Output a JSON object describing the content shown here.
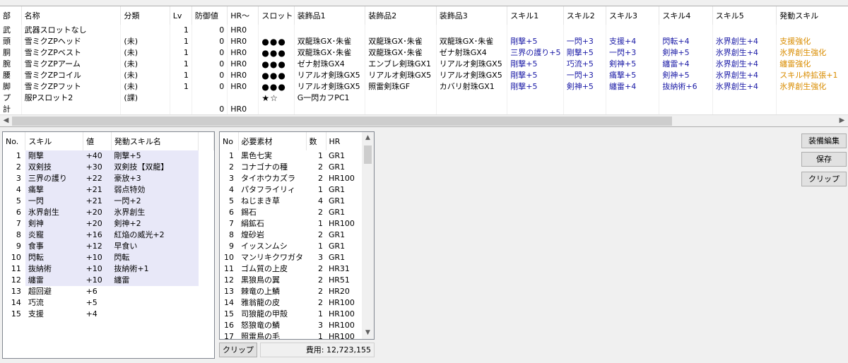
{
  "equip": {
    "headers": [
      "部",
      "名称",
      "分類",
      "Lv",
      "防御値",
      "HR〜",
      "スロット",
      "装飾品1",
      "装飾品2",
      "装飾品3",
      "スキル1",
      "スキル2",
      "スキル3",
      "スキル4",
      "スキル5",
      "発動スキル"
    ],
    "rows": [
      [
        "武",
        "武器スロットなし",
        "",
        "1",
        "0",
        "HR0",
        "",
        "",
        "",
        "",
        "",
        "",
        "",
        "",
        "",
        ""
      ],
      [
        "頭",
        "雪ミクZPヘッド",
        "(未)",
        "1",
        "0",
        "HR0",
        "●●●",
        "双龍珠GX･朱雀",
        "双龍珠GX･朱雀",
        "双龍珠GX･朱雀",
        "剛撃+5",
        "一閃+3",
        "支援+4",
        "閃転+4",
        "氷界創生+4",
        "支援強化"
      ],
      [
        "胴",
        "雪ミクZPベスト",
        "(未)",
        "1",
        "0",
        "HR0",
        "●●●",
        "双龍珠GX･朱雀",
        "双龍珠GX･朱雀",
        "ゼナ射珠GX4",
        "三界の護り+5",
        "剛撃+5",
        "一閃+3",
        "剣神+5",
        "氷界創生+4",
        "氷界創生強化"
      ],
      [
        "腕",
        "雪ミクZPアーム",
        "(未)",
        "1",
        "0",
        "HR0",
        "●●●",
        "ゼナ射珠GX4",
        "エンブレ剣珠GX1",
        "リアルオ剣珠GX5",
        "剛撃+5",
        "巧流+5",
        "剣神+5",
        "纏雷+4",
        "氷界創生+4",
        "纏雷強化"
      ],
      [
        "腰",
        "雪ミクZPコイル",
        "(未)",
        "1",
        "0",
        "HR0",
        "●●●",
        "リアルオ剣珠GX5",
        "リアルオ剣珠GX5",
        "リアルオ剣珠GX5",
        "剛撃+5",
        "一閃+3",
        "痛撃+5",
        "剣神+5",
        "氷界創生+4",
        "スキル枠拡張+1"
      ],
      [
        "脚",
        "雪ミクZPフット",
        "(未)",
        "1",
        "0",
        "HR0",
        "●●●",
        "リアルオ剣珠GX5",
        "照雷剣珠GF",
        "カバリ射珠GX1",
        "剛撃+5",
        "剣神+5",
        "纏雷+4",
        "抜納術+6",
        "氷界創生+4",
        "氷界創生強化"
      ],
      [
        "プ",
        "服Pスロット2",
        "(課)",
        "",
        "",
        "",
        "★☆",
        "G一閃カフPC1",
        "",
        "",
        "",
        "",
        "",
        "",
        "",
        ""
      ],
      [
        "計",
        "",
        "",
        "",
        "0",
        "HR0",
        "",
        "",
        "",
        "",
        "",
        "",
        "",
        "",
        "",
        ""
      ]
    ]
  },
  "skills": {
    "headers": [
      "No.",
      "スキル",
      "値",
      "発動スキル名"
    ],
    "rows": [
      [
        "1",
        "剛撃",
        "+40",
        "剛撃+5"
      ],
      [
        "2",
        "双剣技",
        "+30",
        "双剣技【双龍】"
      ],
      [
        "3",
        "三界の護り",
        "+22",
        "豪放+3"
      ],
      [
        "4",
        "痛撃",
        "+21",
        "弱点特効"
      ],
      [
        "5",
        "一閃",
        "+21",
        "一閃+2"
      ],
      [
        "6",
        "氷界創生",
        "+20",
        "氷界創生"
      ],
      [
        "7",
        "剣神",
        "+20",
        "剣神+2"
      ],
      [
        "8",
        "炎寵",
        "+16",
        "紅焔の威光+2"
      ],
      [
        "9",
        "食事",
        "+12",
        "早食い"
      ],
      [
        "10",
        "閃転",
        "+10",
        "閃転"
      ],
      [
        "11",
        "抜納術",
        "+10",
        "抜納術+1"
      ],
      [
        "12",
        "纏雷",
        "+10",
        "纏雷"
      ],
      [
        "13",
        "超回避",
        "+6",
        ""
      ],
      [
        "14",
        "巧流",
        "+5",
        ""
      ],
      [
        "15",
        "支援",
        "+4",
        ""
      ]
    ]
  },
  "materials": {
    "headers": [
      "No",
      "必要素材",
      "数",
      "HR"
    ],
    "rows": [
      [
        "1",
        "黒色七実",
        "1",
        "GR1"
      ],
      [
        "2",
        "コナゴナの種",
        "2",
        "GR1"
      ],
      [
        "3",
        "タイホウカズラ",
        "2",
        "HR100"
      ],
      [
        "4",
        "パタフライリィ",
        "1",
        "GR1"
      ],
      [
        "5",
        "ねじまき草",
        "4",
        "GR1"
      ],
      [
        "6",
        "錫石",
        "2",
        "GR1"
      ],
      [
        "7",
        "絹鉱石",
        "1",
        "HR100"
      ],
      [
        "8",
        "煌砂岩",
        "2",
        "GR1"
      ],
      [
        "9",
        "イッスンムシ",
        "1",
        "GR1"
      ],
      [
        "10",
        "マンリキクワガタ",
        "3",
        "GR1"
      ],
      [
        "11",
        "ゴム質の上皮",
        "2",
        "HR31"
      ],
      [
        "12",
        "黒狼鳥の翼",
        "2",
        "HR51"
      ],
      [
        "13",
        "棘竜の上鱗",
        "2",
        "HR20"
      ],
      [
        "14",
        "雅翁龍の皮",
        "2",
        "HR100"
      ],
      [
        "15",
        "司狼龍の甲殻",
        "1",
        "HR100"
      ],
      [
        "16",
        "怒狼竜の鱗",
        "3",
        "HR100"
      ],
      [
        "17",
        "照雷鳥の毛",
        "1",
        "HR100"
      ]
    ]
  },
  "buttons": {
    "clip_bottom": "クリップ",
    "edit": "装備編集",
    "save": "保存",
    "clip": "クリップ"
  },
  "cost": "費用: 12,723,155",
  "colors": {
    "skill_text": "#1a1aa6",
    "activated_text": "#d98c00",
    "highlight_row": "#e8e8f8"
  },
  "icons": {
    "scroll_left": "◀",
    "scroll_right": "▶",
    "scroll_up": "▲",
    "scroll_down": "▼"
  }
}
